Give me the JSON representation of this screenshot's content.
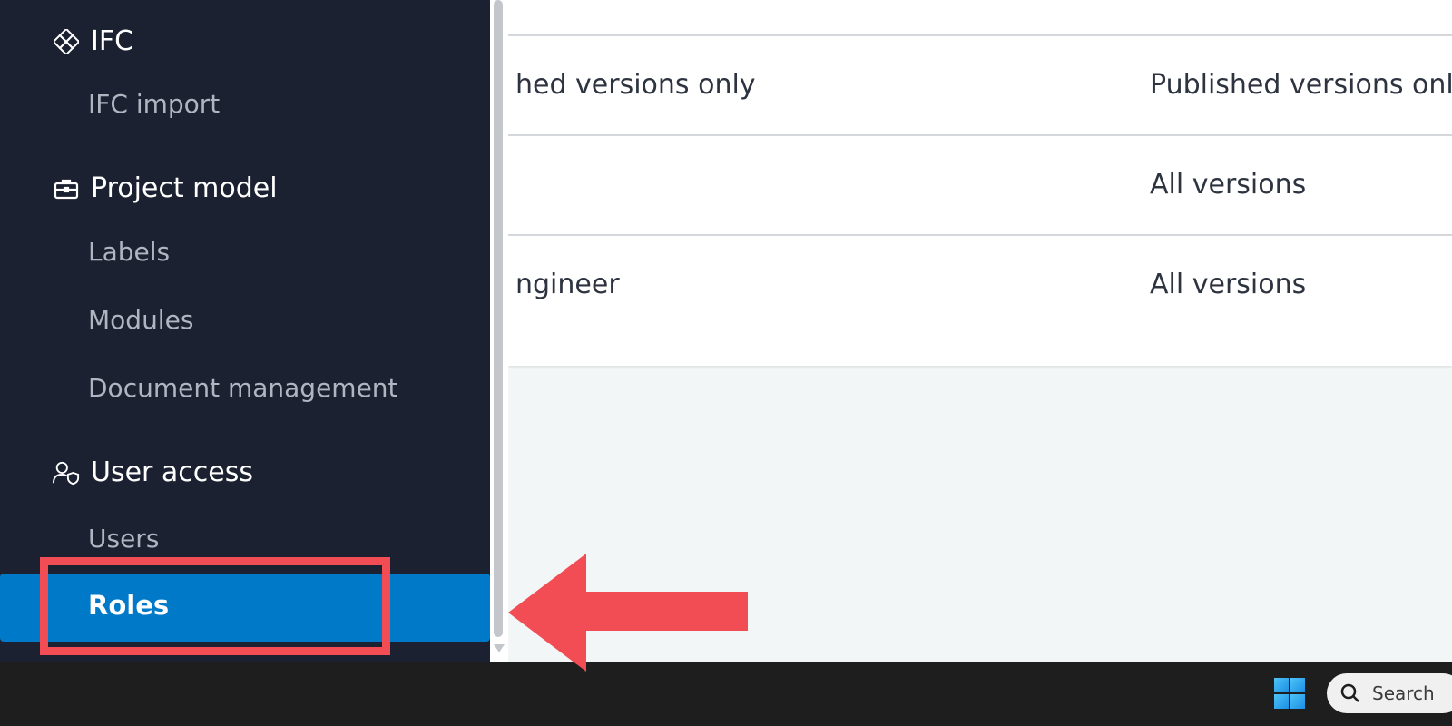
{
  "sidebar": {
    "sections": [
      {
        "title": "IFC",
        "icon": "ifc-icon",
        "items": [
          "IFC import"
        ]
      },
      {
        "title": "Project model",
        "icon": "briefcase-icon",
        "items": [
          "Labels",
          "Modules",
          "Document management"
        ]
      },
      {
        "title": "User access",
        "icon": "user-shield-icon",
        "items": [
          "Users",
          "Roles"
        ]
      }
    ],
    "active_item": "Roles"
  },
  "table": {
    "rows": [
      {
        "col1": "hed versions only",
        "col2": "Published versions only"
      },
      {
        "col1": "",
        "col2": "All versions"
      },
      {
        "col1": "ngineer",
        "col2": "All versions"
      }
    ]
  },
  "taskbar": {
    "search_placeholder": "Search",
    "icons": [
      "windows-start-icon",
      "search-icon"
    ]
  },
  "annotation": {
    "highlight_color": "#f24d55",
    "arrow_color": "#f24d55"
  },
  "colors": {
    "sidebar_bg": "#1b2130",
    "active_bg": "#0079c9"
  }
}
